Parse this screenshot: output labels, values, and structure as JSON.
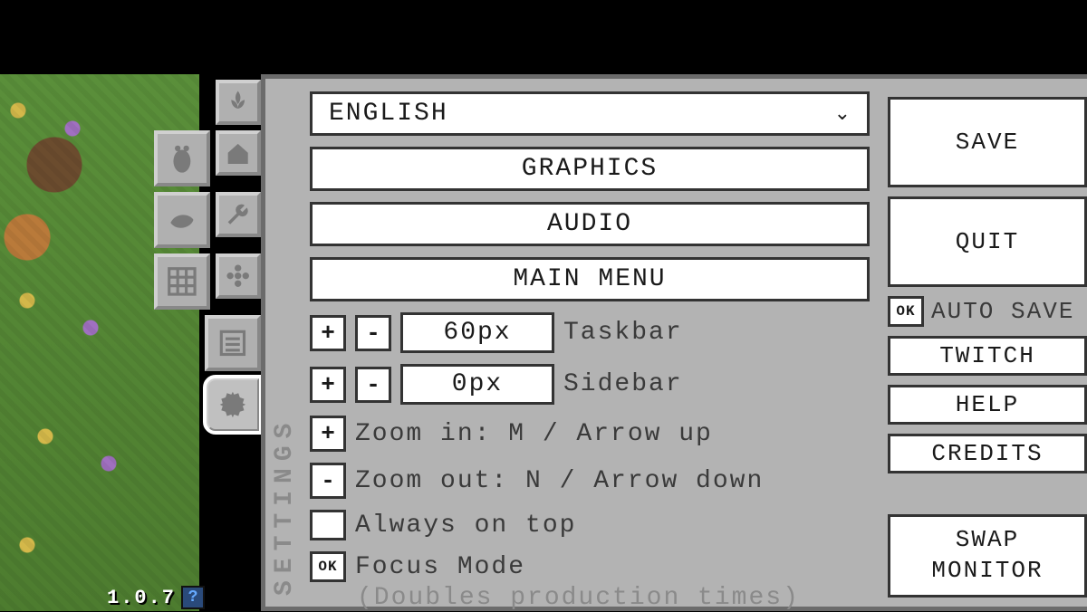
{
  "version": "1.0.7",
  "panel_title": "SETTINGS",
  "language": {
    "selected": "ENGLISH"
  },
  "sections": {
    "graphics": "GRAPHICS",
    "audio": "AUDIO",
    "main_menu": "MAIN MENU"
  },
  "taskbar": {
    "value": "60px",
    "label": "Taskbar"
  },
  "sidebar_offset": {
    "value": "0px",
    "label": "Sidebar"
  },
  "zoom_in": {
    "prefix": "+",
    "text": "Zoom in: M / Arrow up"
  },
  "zoom_out": {
    "prefix": "-",
    "text": "Zoom out: N / Arrow down"
  },
  "always_on_top": {
    "label": "Always on top",
    "checked": false
  },
  "focus_mode": {
    "label": "Focus Mode",
    "checked": true,
    "note": "(Doubles production times)"
  },
  "checkbox_glyph": "OK",
  "right": {
    "save": "SAVE",
    "quit": "QUIT",
    "auto_save": {
      "label": "AUTO SAVE",
      "checked": true
    },
    "twitch": "TWITCH",
    "help": "HELP",
    "credits": "CREDITS",
    "swap_monitor_1": "SWAP",
    "swap_monitor_2": "MONITOR"
  },
  "sidebar_icons": [
    "plant-icon",
    "bee-icon",
    "barn-icon",
    "bird-icon",
    "wrench-icon",
    "grid-icon",
    "flower-icon",
    "list-icon",
    "gear-icon"
  ]
}
